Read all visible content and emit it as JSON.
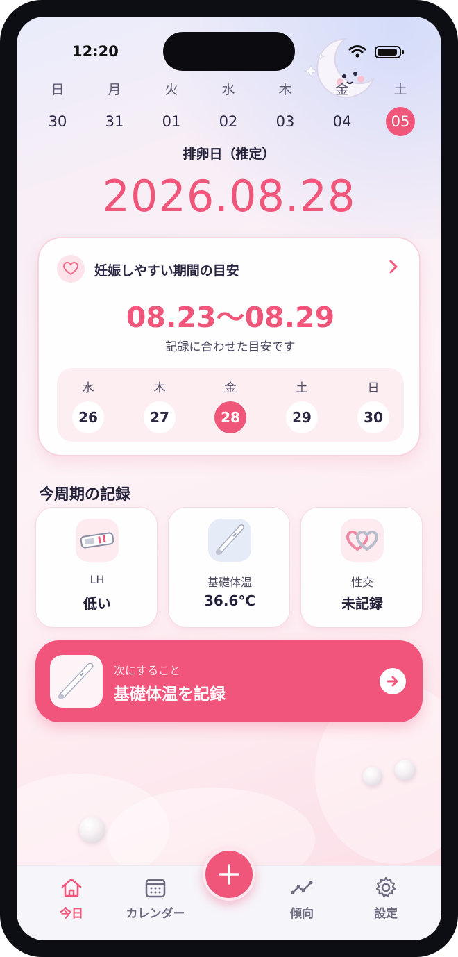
{
  "status_bar": {
    "time": "12:20"
  },
  "week": {
    "days": [
      {
        "name": "日",
        "date": "30"
      },
      {
        "name": "月",
        "date": "31"
      },
      {
        "name": "火",
        "date": "01"
      },
      {
        "name": "水",
        "date": "02"
      },
      {
        "name": "木",
        "date": "03"
      },
      {
        "name": "金",
        "date": "04"
      },
      {
        "name": "土",
        "date": "05"
      }
    ],
    "selected_index": 6
  },
  "ovulation": {
    "label": "排卵日（推定）",
    "date": "2026.08.28"
  },
  "fertile_card": {
    "title": "妊娠しやすい期間の目安",
    "range": "08.23～08.29",
    "note": "記録に合わせた目安です",
    "days": [
      {
        "name": "水",
        "date": "26"
      },
      {
        "name": "木",
        "date": "27"
      },
      {
        "name": "金",
        "date": "28"
      },
      {
        "name": "土",
        "date": "29"
      },
      {
        "name": "日",
        "date": "30"
      }
    ],
    "selected_index": 2
  },
  "records": {
    "title": "今周期の記録",
    "items": [
      {
        "label": "LH",
        "value": "低い",
        "icon": "lh-test-strip-icon"
      },
      {
        "label": "基礎体温",
        "value": "36.6°C",
        "icon": "thermometer-icon"
      },
      {
        "label": "性交",
        "value": "未記録",
        "icon": "linked-hearts-icon"
      }
    ]
  },
  "next_action": {
    "label": "次にすること",
    "title": "基礎体温を記録"
  },
  "tabbar": {
    "items": [
      {
        "label": "今日",
        "icon": "home-icon"
      },
      {
        "label": "カレンダー",
        "icon": "calendar-icon"
      },
      {
        "label": "傾向",
        "icon": "trend-icon"
      },
      {
        "label": "設定",
        "icon": "gear-icon"
      }
    ],
    "active_index": 0
  },
  "colors": {
    "accent": "#f0557a",
    "card_bg": "#ffffff",
    "tab_bg": "#f6f5fa"
  }
}
